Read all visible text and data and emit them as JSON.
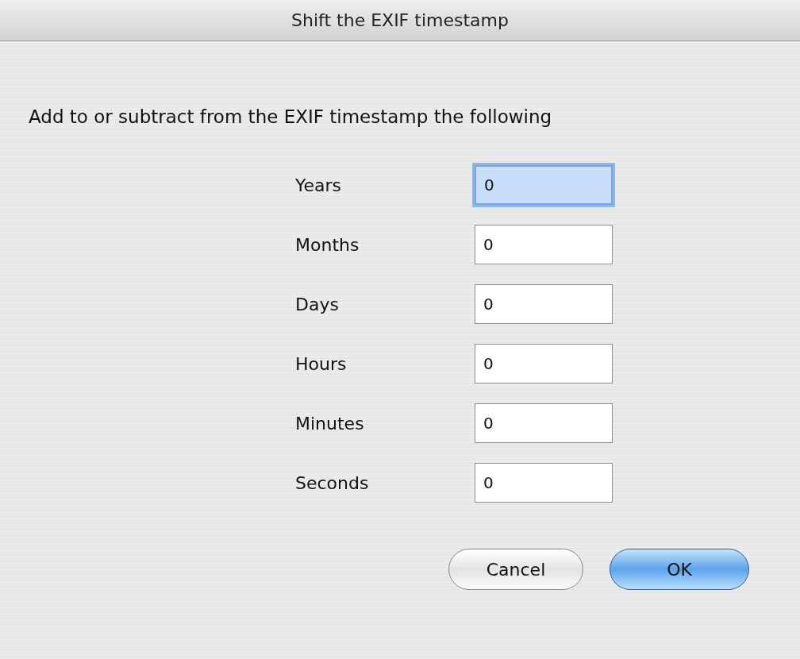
{
  "window": {
    "title": "Shift the EXIF timestamp"
  },
  "instruction": "Add to or subtract from the EXIF timestamp the following",
  "fields": [
    {
      "label": "Years",
      "value": "0",
      "focused": true
    },
    {
      "label": "Months",
      "value": "0",
      "focused": false
    },
    {
      "label": "Days",
      "value": "0",
      "focused": false
    },
    {
      "label": "Hours",
      "value": "0",
      "focused": false
    },
    {
      "label": "Minutes",
      "value": "0",
      "focused": false
    },
    {
      "label": "Seconds",
      "value": "0",
      "focused": false
    }
  ],
  "buttons": [
    {
      "label": "Cancel",
      "kind": "secondary"
    },
    {
      "label": "OK",
      "kind": "default"
    }
  ]
}
